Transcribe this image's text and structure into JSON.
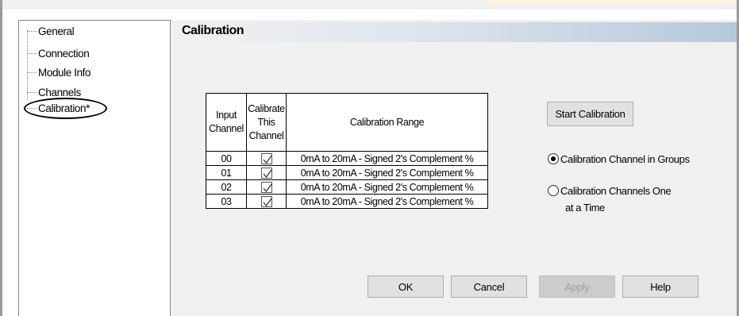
{
  "tree": {
    "items": [
      {
        "label": "General"
      },
      {
        "label": "Connection"
      },
      {
        "label": "Module Info"
      },
      {
        "label": "Channels"
      },
      {
        "label": "Calibration*"
      }
    ]
  },
  "page": {
    "title": "Calibration"
  },
  "table": {
    "headers": {
      "input_channel": [
        "Input",
        "Channel"
      ],
      "calibrate": [
        "Calibrate",
        "This",
        "Channel"
      ],
      "range": "Calibration Range"
    },
    "rows": [
      {
        "channel": "00",
        "checked": true,
        "range": "0mA to 20mA - Signed 2's Complement %"
      },
      {
        "channel": "01",
        "checked": true,
        "range": "0mA to 20mA - Signed 2's Complement %"
      },
      {
        "channel": "02",
        "checked": true,
        "range": "0mA to 20mA - Signed 2's Complement %"
      },
      {
        "channel": "03",
        "checked": true,
        "range": "0mA to 20mA - Signed 2's Complement %"
      }
    ]
  },
  "start_button": {
    "label": "Start Calibration"
  },
  "radios": {
    "groups": {
      "label": "Calibration Channel in Groups",
      "selected": true
    },
    "one_at_a_time": {
      "label_line1": "Calibration Channels One",
      "label_line2": "at a Time",
      "selected": false
    }
  },
  "buttons": {
    "ok": "OK",
    "cancel": "Cancel",
    "apply": "Apply",
    "help": "Help"
  }
}
